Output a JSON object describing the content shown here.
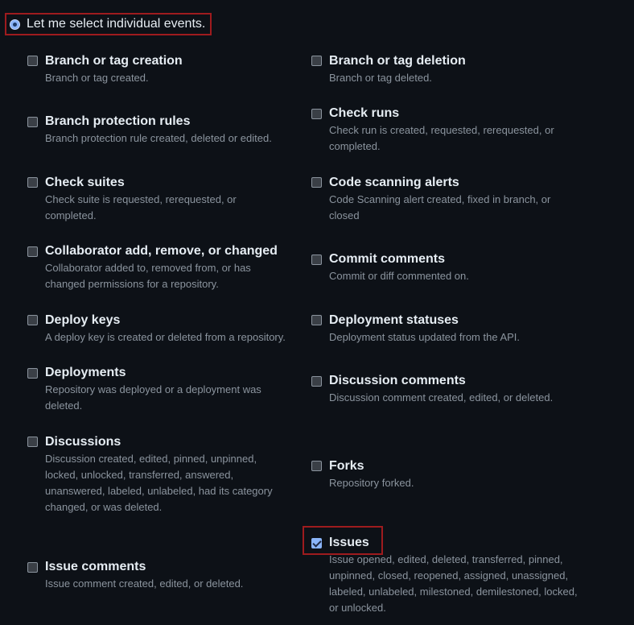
{
  "selection": {
    "label": "Let me select individual events."
  },
  "events_left": [
    {
      "title": "Branch or tag creation",
      "desc": "Branch or tag created.",
      "checked": false
    },
    {
      "title": "Branch protection rules",
      "desc": "Branch protection rule created, deleted or edited.",
      "checked": false
    },
    {
      "title": "Check suites",
      "desc": "Check suite is requested, rerequested, or completed.",
      "checked": false
    },
    {
      "title": "Collaborator add, remove, or changed",
      "desc": "Collaborator added to, removed from, or has changed permissions for a repository.",
      "checked": false
    },
    {
      "title": "Deploy keys",
      "desc": "A deploy key is created or deleted from a repository.",
      "checked": false
    },
    {
      "title": "Deployments",
      "desc": "Repository was deployed or a deployment was deleted.",
      "checked": false
    },
    {
      "title": "Discussions",
      "desc": "Discussion created, edited, pinned, unpinned, locked, unlocked, transferred, answered, unanswered, labeled, unlabeled, had its category changed, or was deleted.",
      "checked": false
    },
    {
      "title": "Issue comments",
      "desc": "Issue comment created, edited, or deleted.",
      "checked": false
    }
  ],
  "events_right": [
    {
      "title": "Branch or tag deletion",
      "desc": "Branch or tag deleted.",
      "checked": false
    },
    {
      "title": "Check runs",
      "desc": "Check run is created, requested, rerequested, or completed.",
      "checked": false
    },
    {
      "title": "Code scanning alerts",
      "desc": "Code Scanning alert created, fixed in branch, or closed",
      "checked": false
    },
    {
      "title": "Commit comments",
      "desc": "Commit or diff commented on.",
      "checked": false
    },
    {
      "title": "Deployment statuses",
      "desc": "Deployment status updated from the API.",
      "checked": false
    },
    {
      "title": "Discussion comments",
      "desc": "Discussion comment created, edited, or deleted.",
      "checked": false
    },
    {
      "title": "Forks",
      "desc": "Repository forked.",
      "checked": false
    },
    {
      "title": "Issues",
      "desc": "Issue opened, edited, deleted, transferred, pinned, unpinned, closed, reopened, assigned, unassigned, labeled, unlabeled, milestoned, demilestoned, locked, or unlocked.",
      "checked": true
    }
  ]
}
